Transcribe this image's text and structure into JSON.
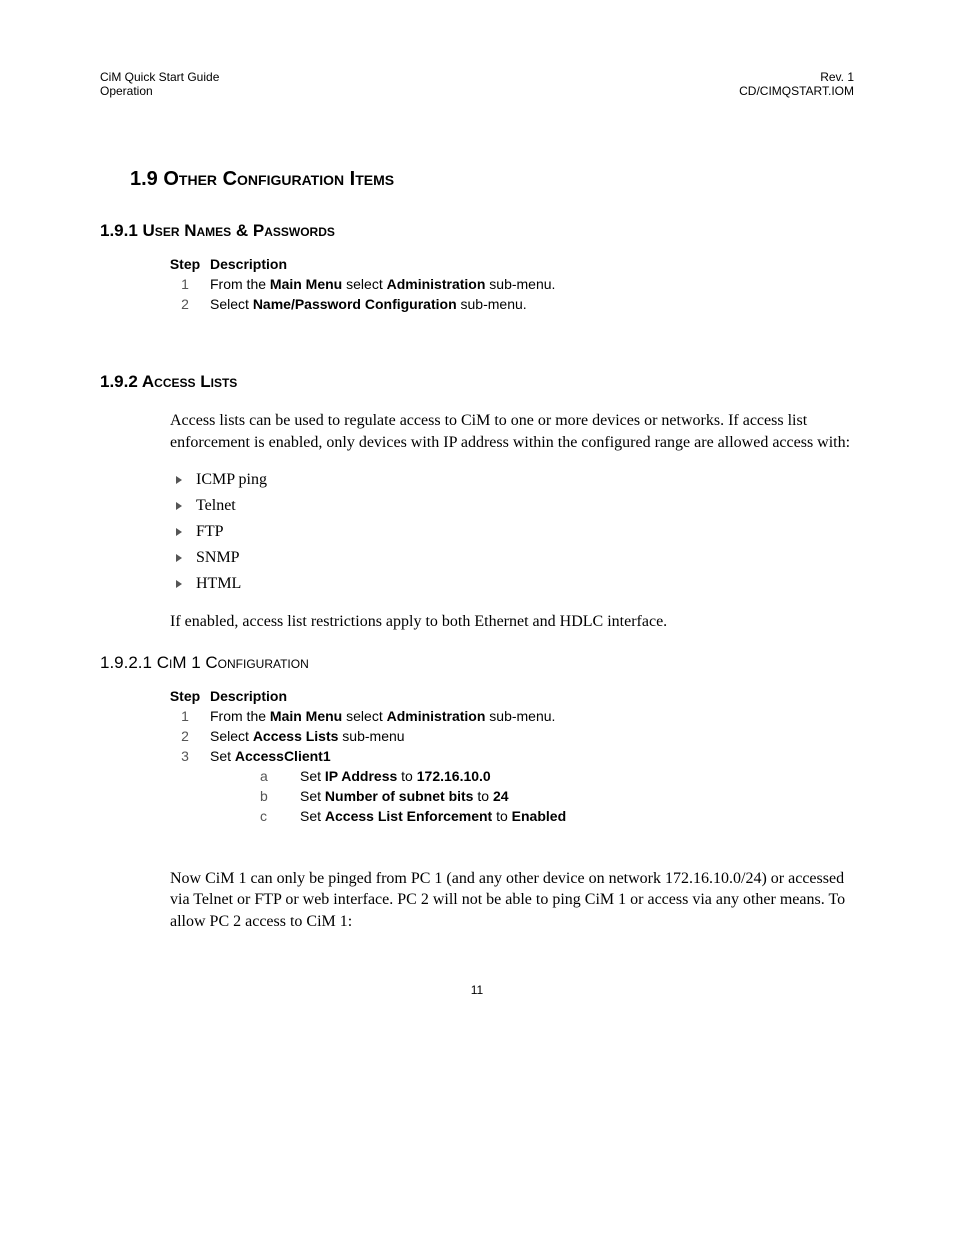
{
  "header": {
    "left_line1": "CiM Quick Start Guide",
    "left_line2": "Operation",
    "right_line1": "Rev. 1",
    "right_line2": "CD/CIMQSTART.IOM"
  },
  "section": {
    "number": "1.9",
    "title": "Other Configuration Items"
  },
  "sub_191": {
    "heading": "1.9.1 User Names & Passwords",
    "table": {
      "head_step": "Step",
      "head_desc": "Description",
      "row1_step": "1",
      "row1_pre": "From the ",
      "row1_b1": "Main Menu",
      "row1_mid": " select ",
      "row1_b2": "Administration",
      "row1_post": " sub-menu.",
      "row2_step": "2",
      "row2_pre": "Select ",
      "row2_b1": "Name/Password Configuration",
      "row2_post": " sub-menu."
    }
  },
  "sub_192": {
    "heading": "1.9.2 Access Lists",
    "para1": "Access lists can be used to regulate access to CiM to one or more devices or networks. If access list enforcement is enabled, only devices with IP address within the configured range are allowed access with:",
    "bullets": {
      "b1": "ICMP ping",
      "b2": "Telnet",
      "b3": "FTP",
      "b4": "SNMP",
      "b5": "HTML"
    },
    "para2": "If enabled, access list restrictions apply to both Ethernet and HDLC interface."
  },
  "sub_1921": {
    "heading": "1.9.2.1 CiM 1 Configuration",
    "table": {
      "head_step": "Step",
      "head_desc": "Description",
      "row1_step": "1",
      "row1_pre": "From the ",
      "row1_b1": "Main Menu",
      "row1_mid": " select ",
      "row1_b2": "Administration",
      "row1_post": " sub-menu.",
      "row2_step": "2",
      "row2_pre": "Select ",
      "row2_b1": "Access Lists",
      "row2_post": " sub-menu",
      "row3_step": "3",
      "row3_pre": "Set ",
      "row3_b1": "AccessClient1",
      "sub_a_step": "a",
      "sub_a_pre": "Set ",
      "sub_a_b1": "IP Address",
      "sub_a_mid": " to ",
      "sub_a_b2": "172.16.10.0",
      "sub_b_step": "b",
      "sub_b_pre": "Set ",
      "sub_b_b1": "Number of subnet bits",
      "sub_b_mid": " to ",
      "sub_b_b2": "24",
      "sub_c_step": "c",
      "sub_c_pre": "Set ",
      "sub_c_b1": "Access List Enforcement",
      "sub_c_mid": " to ",
      "sub_c_b2": "Enabled"
    },
    "para_after": "Now CiM 1 can only be pinged from PC 1 (and any other device on network 172.16.10.0/24) or accessed via Telnet or FTP or web interface. PC 2 will not be able to ping CiM 1 or access via any other means. To allow PC 2 access to CiM 1:"
  },
  "page_number": "11"
}
